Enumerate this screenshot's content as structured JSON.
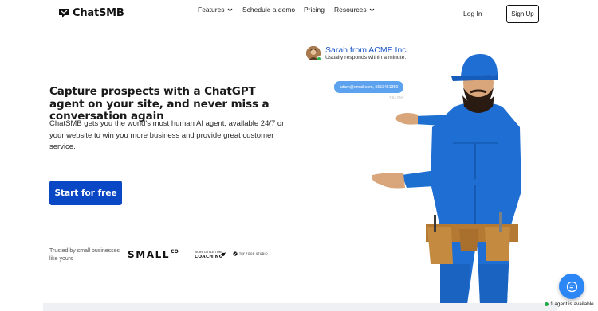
{
  "brand": {
    "name": "ChatSMB"
  },
  "nav": {
    "features": "Features",
    "schedule_demo": "Schedule a demo",
    "pricing": "Pricing",
    "resources": "Resources",
    "login": "Log In",
    "signup": "Sign Up"
  },
  "hero": {
    "title": "Capture prospects with a ChatGPT agent on your site, and never miss a conversation again",
    "subtitle": "ChatSMB gets you the world's most human AI agent, available 24/7 on your website to win you more business and provide great customer service.",
    "cta": "Start for free"
  },
  "trust": {
    "label": "Trusted by small businesses like yours",
    "logos": {
      "smallco": "SMALL",
      "smallco_suffix": "CO",
      "coaching_top": "MORE LITTLE TIME",
      "coaching_bottom": "COACHING",
      "third": "TRY FOOD STUDIO"
    }
  },
  "chat_preview": {
    "agent_name": "Sarah from ACME Inc.",
    "response_note": "Usually responds within a minute.",
    "user_message": "adam@email.com, 5553451359",
    "timestamp": "7:54 PM"
  },
  "widget": {
    "agent_status": "1 agent is available",
    "status_color": "#1fa84a",
    "launcher_color": "#2c86f5"
  },
  "colors": {
    "accent": "#0a47c4",
    "link": "#1a56c9"
  }
}
